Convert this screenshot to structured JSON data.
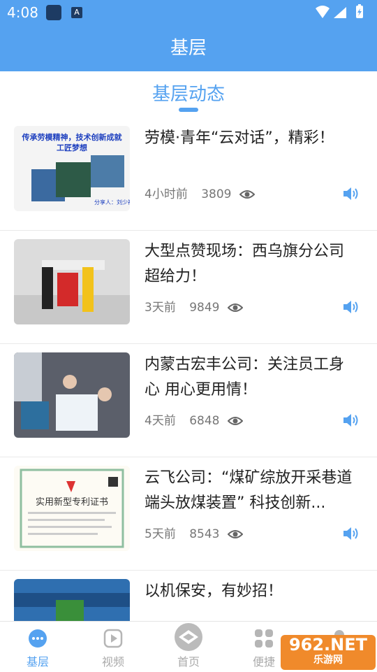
{
  "status": {
    "time": "4:08",
    "a_icon": "A",
    "icons": [
      "wifi-icon",
      "signal-icon",
      "battery-icon"
    ]
  },
  "header": {
    "title": "基层"
  },
  "section": {
    "title": "基层动态"
  },
  "items": [
    {
      "title": "劳模·青年“云对话”，精彩！",
      "time": "4小时前",
      "views": "3809"
    },
    {
      "title": "大型点赞现场：西乌旗分公司超给力！",
      "time": "3天前",
      "views": "9849"
    },
    {
      "title": "内蒙古宏丰公司：关注员工身心 用心更用情！",
      "time": "4天前",
      "views": "6848"
    },
    {
      "title": "云飞公司：“煤矿综放开采巷道端头放煤装置” 科技创新...",
      "time": "5天前",
      "views": "8543"
    },
    {
      "title": "以机保安，有妙招！",
      "time": "",
      "views": ""
    }
  ],
  "thumb1": {
    "line1": "传承劳模精神，技术创新成就",
    "line2": "工匠梦想",
    "sign": "分享人：刘少祥"
  },
  "thumb4": {
    "title": "实用新型专利证书"
  },
  "nav": [
    {
      "label": "基层",
      "active": true
    },
    {
      "label": "视频"
    },
    {
      "label": "首页"
    },
    {
      "label": "便捷"
    },
    {
      "label": ""
    }
  ],
  "watermark": {
    "line1": "962.NET",
    "line2": "乐游网"
  },
  "colors": {
    "accent": "#55a2f0",
    "header_bg": "#55a2f0"
  }
}
